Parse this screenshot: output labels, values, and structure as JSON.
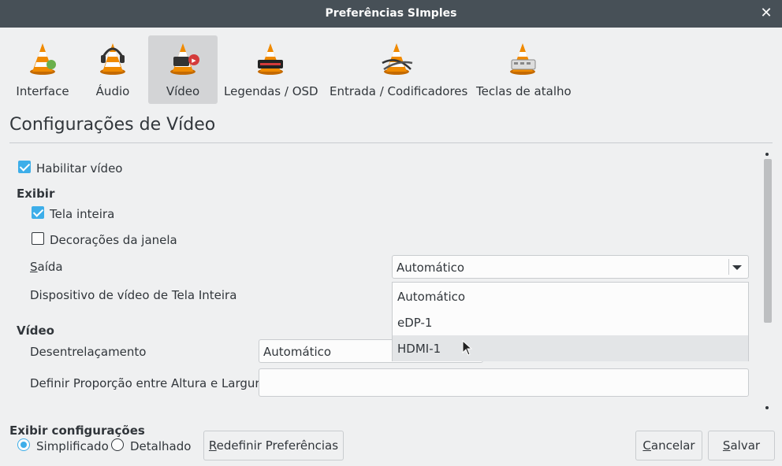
{
  "window": {
    "title": "Preferências SImples",
    "close_icon": "close-icon"
  },
  "tabs": [
    {
      "label": "Interface",
      "icon": "vlc-cone-interface-icon",
      "selected": false
    },
    {
      "label": "Áudio",
      "icon": "vlc-cone-headphones-icon",
      "selected": false
    },
    {
      "label": "Vídeo",
      "icon": "vlc-cone-video-icon",
      "selected": true
    },
    {
      "label": "Legendas / OSD",
      "icon": "vlc-cone-subtitles-icon",
      "selected": false
    },
    {
      "label": "Entrada / Codificadores",
      "icon": "vlc-cone-cables-icon",
      "selected": false
    },
    {
      "label": "Teclas de atalho",
      "icon": "vlc-cone-hotkeys-icon",
      "selected": false
    }
  ],
  "section": {
    "title": "Configurações de Vídeo"
  },
  "enable_video": {
    "label": "Habilitar vídeo",
    "checked": true
  },
  "display": {
    "heading": "Exibir",
    "fullscreen": {
      "label": "Tela inteira",
      "checked": true
    },
    "decorations": {
      "label": "Decorações da janela",
      "checked": false
    },
    "output": {
      "label": "Saída",
      "mnemonic": "S",
      "rest": "aída",
      "value": "Automático"
    },
    "fullscreen_device": {
      "label": "Dispositivo de vídeo de Tela Inteira"
    }
  },
  "dropdown": {
    "options": [
      "Automático",
      "eDP-1",
      "HDMI-1"
    ],
    "hovered": "HDMI-1"
  },
  "video": {
    "heading": "Vídeo",
    "deinterlace": {
      "label": "Desentrelaçamento",
      "value": "Automático"
    },
    "aspect_ratio": {
      "label": "Definir Proporção entre Altura e Largura",
      "value": ""
    }
  },
  "footer": {
    "show_settings_label": "Exibir configurações",
    "simple": {
      "label": "Simplificado",
      "checked": true
    },
    "detailed": {
      "label": "Detalhado",
      "checked": false
    },
    "reset": {
      "mnemonic": "R",
      "rest": "edefinir Preferências"
    },
    "cancel": {
      "mnemonic": "C",
      "rest": "ancelar"
    },
    "save": {
      "mnemonic": "S",
      "rest": "alvar"
    }
  },
  "colors": {
    "accent": "#3daee9",
    "titlebar": "#475057",
    "background": "#eff0f1",
    "cone_orange": "#f08a00"
  }
}
